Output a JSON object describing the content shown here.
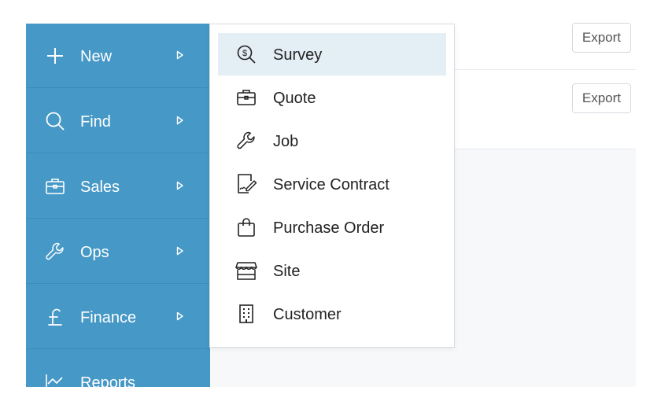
{
  "content": {
    "export_label": "Export"
  },
  "sidebar": {
    "items": [
      {
        "label": "New",
        "icon": "plus-icon"
      },
      {
        "label": "Find",
        "icon": "search-icon"
      },
      {
        "label": "Sales",
        "icon": "briefcase-icon"
      },
      {
        "label": "Ops",
        "icon": "wrench-icon"
      },
      {
        "label": "Finance",
        "icon": "pound-icon"
      },
      {
        "label": "Reports",
        "icon": "chart-icon"
      }
    ]
  },
  "menu": {
    "items": [
      {
        "label": "Survey",
        "icon": "search-dollar-icon",
        "active": true
      },
      {
        "label": "Quote",
        "icon": "briefcase-icon"
      },
      {
        "label": "Job",
        "icon": "wrench-icon"
      },
      {
        "label": "Service Contract",
        "icon": "signed-document-icon"
      },
      {
        "label": "Purchase Order",
        "icon": "shopping-bag-icon"
      },
      {
        "label": "Site",
        "icon": "storefront-icon"
      },
      {
        "label": "Customer",
        "icon": "building-icon"
      }
    ]
  },
  "colors": {
    "sidebar_bg": "#4698c6",
    "menu_active_bg": "#e4eef5",
    "content_bg": "#f7f8fa"
  }
}
